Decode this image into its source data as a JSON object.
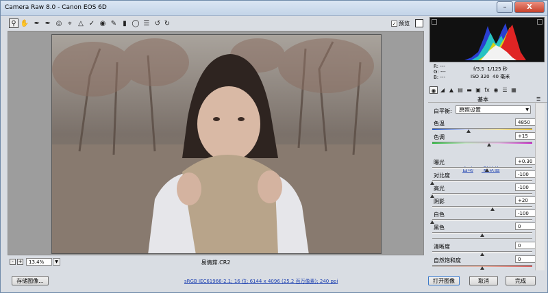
{
  "window": {
    "title": "Camera Raw 8.0 -  Canon EOS 6D",
    "close_symbol": "X",
    "minimize_symbol": "–"
  },
  "toolbar": {
    "tools": [
      "zoom-icon",
      "hand-icon",
      "white-balance-icon",
      "color-sampler-icon",
      "target-adjust-icon",
      "crop-icon",
      "straighten-icon",
      "spot-removal-icon",
      "red-eye-icon",
      "adjustment-brush-icon",
      "graduated-filter-icon",
      "radial-filter-icon",
      "preferences-icon",
      "rotate-ccw-icon",
      "rotate-cw-icon"
    ],
    "preview_label": "预览",
    "preview_checked": true
  },
  "image": {
    "filename": "易倩茹.CR2",
    "zoom": "13.4%"
  },
  "camera_info": {
    "r_label": "R:",
    "g_label": "G:",
    "b_label": "B:",
    "rgb_value": "---",
    "aperture": "f/3.5",
    "shutter": "1/125 秒",
    "iso": "ISO 320",
    "focal": "40 毫米"
  },
  "panel": {
    "section_title": "基本",
    "wb_label": "白平衡:",
    "wb_value": "原照设置",
    "auto_label": "自动",
    "default_label": "默认值",
    "sliders": [
      {
        "name": "temperature",
        "label": "色温",
        "value": "4850",
        "pos": 0.36
      },
      {
        "name": "tint",
        "label": "色调",
        "value": "+15",
        "pos": 0.57
      },
      {
        "name": "exposure",
        "label": "曝光",
        "value": "+0.30",
        "pos": 0.55
      },
      {
        "name": "contrast",
        "label": "对比度",
        "value": "-100",
        "pos": 0.0
      },
      {
        "name": "highlights",
        "label": "高光",
        "value": "-100",
        "pos": 0.0
      },
      {
        "name": "shadows",
        "label": "阴影",
        "value": "+20",
        "pos": 0.6
      },
      {
        "name": "whites",
        "label": "白色",
        "value": "-100",
        "pos": 0.0
      },
      {
        "name": "blacks",
        "label": "黑色",
        "value": "0",
        "pos": 0.5
      },
      {
        "name": "clarity",
        "label": "清晰度",
        "value": "0",
        "pos": 0.5
      },
      {
        "name": "vibrance",
        "label": "自然饱和度",
        "value": "0",
        "pos": 0.5
      }
    ]
  },
  "footer": {
    "save_label": "存储图像...",
    "workflow_text": "sRGB IEC61966-2.1; 16 位; 6144 x 4096 (25.2 百万像素); 240 ppi",
    "open_label": "打开图像",
    "cancel_label": "取消",
    "done_label": "完成"
  },
  "colors": {
    "link": "#1a3eb0",
    "default_button_border": "#3a78c9",
    "close_button": "#c7412a"
  }
}
